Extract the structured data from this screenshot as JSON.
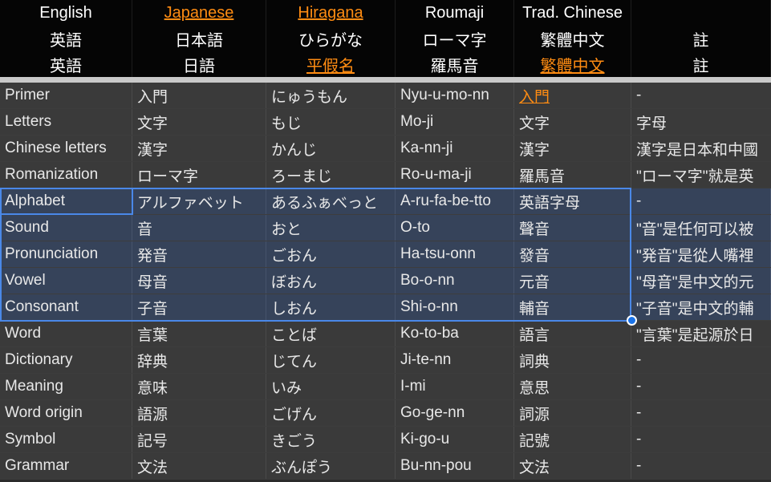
{
  "header": {
    "rows": [
      {
        "cells": [
          {
            "text": "English",
            "style": "plain"
          },
          {
            "text": "Japanese",
            "style": "link"
          },
          {
            "text": "Hiragana",
            "style": "link"
          },
          {
            "text": "Roumaji",
            "style": "plain"
          },
          {
            "text": "Trad. Chinese",
            "style": "plain"
          },
          {
            "text": "",
            "style": "plain"
          }
        ]
      },
      {
        "cells": [
          {
            "text": "英語",
            "style": "plain"
          },
          {
            "text": "日本語",
            "style": "plain"
          },
          {
            "text": "ひらがな",
            "style": "plain"
          },
          {
            "text": "ローマ字",
            "style": "plain"
          },
          {
            "text": "繁體中文",
            "style": "plain"
          },
          {
            "text": "註",
            "style": "plain"
          }
        ]
      },
      {
        "cells": [
          {
            "text": "英語",
            "style": "plain"
          },
          {
            "text": "日語",
            "style": "plain"
          },
          {
            "text": "平假名",
            "style": "link"
          },
          {
            "text": "羅馬音",
            "style": "plain"
          },
          {
            "text": "繁體中文",
            "style": "link"
          },
          {
            "text": "註",
            "style": "plain"
          }
        ]
      }
    ]
  },
  "grid": {
    "rows": [
      {
        "selected": false,
        "cells": [
          {
            "text": "Primer",
            "style": "plain"
          },
          {
            "text": "入門",
            "style": "plain"
          },
          {
            "text": "にゅうもん",
            "style": "plain"
          },
          {
            "text": "Nyu-u-mo-nn",
            "style": "plain"
          },
          {
            "text": "入門",
            "style": "link"
          },
          {
            "text": "-",
            "style": "plain"
          }
        ]
      },
      {
        "selected": false,
        "cells": [
          {
            "text": "Letters",
            "style": "plain"
          },
          {
            "text": "文字",
            "style": "plain"
          },
          {
            "text": "もじ",
            "style": "plain"
          },
          {
            "text": "Mo-ji",
            "style": "plain"
          },
          {
            "text": "文字",
            "style": "plain"
          },
          {
            "text": "字母",
            "style": "plain"
          }
        ]
      },
      {
        "selected": false,
        "cells": [
          {
            "text": "Chinese letters",
            "style": "plain"
          },
          {
            "text": "漢字",
            "style": "plain"
          },
          {
            "text": "かんじ",
            "style": "plain"
          },
          {
            "text": "Ka-nn-ji",
            "style": "plain"
          },
          {
            "text": "漢字",
            "style": "plain"
          },
          {
            "text": "漢字是日本和中國",
            "style": "plain"
          }
        ]
      },
      {
        "selected": false,
        "cells": [
          {
            "text": "Romanization",
            "style": "plain"
          },
          {
            "text": "ローマ字",
            "style": "plain"
          },
          {
            "text": "ろーまじ",
            "style": "plain"
          },
          {
            "text": "Ro-u-ma-ji",
            "style": "plain"
          },
          {
            "text": "羅馬音",
            "style": "plain"
          },
          {
            "text": "\"ローマ字\"就是英",
            "style": "plain"
          }
        ]
      },
      {
        "selected": true,
        "cells": [
          {
            "text": "Alphabet",
            "style": "plain"
          },
          {
            "text": "アルファベット",
            "style": "plain"
          },
          {
            "text": "あるふぁべっと",
            "style": "plain"
          },
          {
            "text": "A-ru-fa-be-tto",
            "style": "plain"
          },
          {
            "text": "英語字母",
            "style": "plain"
          },
          {
            "text": "-",
            "style": "plain"
          }
        ]
      },
      {
        "selected": true,
        "cells": [
          {
            "text": "Sound",
            "style": "plain"
          },
          {
            "text": "音",
            "style": "plain"
          },
          {
            "text": "おと",
            "style": "plain"
          },
          {
            "text": "O-to",
            "style": "plain"
          },
          {
            "text": "聲音",
            "style": "plain"
          },
          {
            "text": "\"音\"是任何可以被",
            "style": "plain"
          }
        ]
      },
      {
        "selected": true,
        "cells": [
          {
            "text": "Pronunciation",
            "style": "plain"
          },
          {
            "text": "発音",
            "style": "plain"
          },
          {
            "text": "ごおん",
            "style": "plain"
          },
          {
            "text": "Ha-tsu-onn",
            "style": "plain"
          },
          {
            "text": "發音",
            "style": "plain"
          },
          {
            "text": "\"発音\"是從人嘴裡",
            "style": "plain"
          }
        ]
      },
      {
        "selected": true,
        "cells": [
          {
            "text": "Vowel",
            "style": "plain"
          },
          {
            "text": "母音",
            "style": "plain"
          },
          {
            "text": "ぼおん",
            "style": "plain"
          },
          {
            "text": "Bo-o-nn",
            "style": "plain"
          },
          {
            "text": "元音",
            "style": "plain"
          },
          {
            "text": "\"母音\"是中文的元",
            "style": "plain"
          }
        ]
      },
      {
        "selected": true,
        "cells": [
          {
            "text": "Consonant",
            "style": "plain"
          },
          {
            "text": "子音",
            "style": "plain"
          },
          {
            "text": "しおん",
            "style": "plain"
          },
          {
            "text": "Shi-o-nn",
            "style": "plain"
          },
          {
            "text": "輔音",
            "style": "plain"
          },
          {
            "text": "\"子音\"是中文的輔",
            "style": "plain"
          }
        ]
      },
      {
        "selected": false,
        "cells": [
          {
            "text": "Word",
            "style": "plain"
          },
          {
            "text": "言葉",
            "style": "plain"
          },
          {
            "text": "ことば",
            "style": "plain"
          },
          {
            "text": "Ko-to-ba",
            "style": "plain"
          },
          {
            "text": "語言",
            "style": "plain"
          },
          {
            "text": "\"言葉\"是起源於日",
            "style": "plain"
          }
        ]
      },
      {
        "selected": false,
        "cells": [
          {
            "text": "Dictionary",
            "style": "plain"
          },
          {
            "text": "辞典",
            "style": "plain"
          },
          {
            "text": "じてん",
            "style": "plain"
          },
          {
            "text": "Ji-te-nn",
            "style": "plain"
          },
          {
            "text": "詞典",
            "style": "plain"
          },
          {
            "text": "-",
            "style": "plain"
          }
        ]
      },
      {
        "selected": false,
        "cells": [
          {
            "text": "Meaning",
            "style": "plain"
          },
          {
            "text": "意味",
            "style": "plain"
          },
          {
            "text": "いみ",
            "style": "plain"
          },
          {
            "text": "I-mi",
            "style": "plain"
          },
          {
            "text": "意思",
            "style": "plain"
          },
          {
            "text": "-",
            "style": "plain"
          }
        ]
      },
      {
        "selected": false,
        "cells": [
          {
            "text": "Word origin",
            "style": "plain"
          },
          {
            "text": "語源",
            "style": "plain"
          },
          {
            "text": "ごげん",
            "style": "plain"
          },
          {
            "text": "Go-ge-nn",
            "style": "plain"
          },
          {
            "text": "詞源",
            "style": "plain"
          },
          {
            "text": "-",
            "style": "plain"
          }
        ]
      },
      {
        "selected": false,
        "cells": [
          {
            "text": "Symbol",
            "style": "plain"
          },
          {
            "text": "記号",
            "style": "plain"
          },
          {
            "text": "きごう",
            "style": "plain"
          },
          {
            "text": "Ki-go-u",
            "style": "plain"
          },
          {
            "text": "記號",
            "style": "plain"
          },
          {
            "text": "-",
            "style": "plain"
          }
        ]
      },
      {
        "selected": false,
        "cells": [
          {
            "text": "Grammar",
            "style": "plain"
          },
          {
            "text": "文法",
            "style": "plain"
          },
          {
            "text": "ぶんぽう",
            "style": "plain"
          },
          {
            "text": "Bu-nn-pou",
            "style": "plain"
          },
          {
            "text": "文法",
            "style": "plain"
          },
          {
            "text": "-",
            "style": "plain"
          }
        ]
      }
    ]
  },
  "colors": {
    "header_background": "#050505",
    "grid_background": "#3a3a3a",
    "selection_background": "#36435a",
    "selection_border": "#4a88e8",
    "fill_handle": "#1a73e8",
    "link_text": "#ff8c12",
    "separator": "#c9c9c9"
  }
}
